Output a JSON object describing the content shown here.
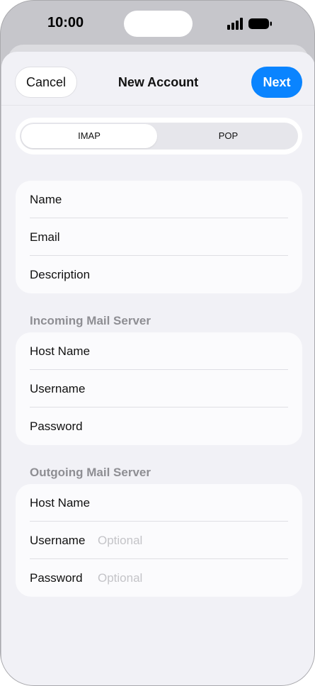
{
  "status_bar": {
    "time": "10:00"
  },
  "nav": {
    "cancel_label": "Cancel",
    "title": "New Account",
    "next_label": "Next"
  },
  "segmented": {
    "options": [
      "IMAP",
      "POP"
    ],
    "selected": "IMAP"
  },
  "account_group": {
    "fields": [
      {
        "label": "Name"
      },
      {
        "label": "Email"
      },
      {
        "label": "Description"
      }
    ]
  },
  "incoming": {
    "header": "Incoming Mail Server",
    "fields": [
      {
        "label": "Host Name"
      },
      {
        "label": "Username"
      },
      {
        "label": "Password"
      }
    ]
  },
  "outgoing": {
    "header": "Outgoing Mail Server",
    "fields": [
      {
        "label": "Host Name"
      },
      {
        "label": "Username",
        "placeholder": "Optional"
      },
      {
        "label": "Password",
        "placeholder": "Optional"
      }
    ]
  },
  "colors": {
    "accent": "#0a84ff",
    "background": "#f1f1f6",
    "placeholder": "#c4c4c8"
  }
}
